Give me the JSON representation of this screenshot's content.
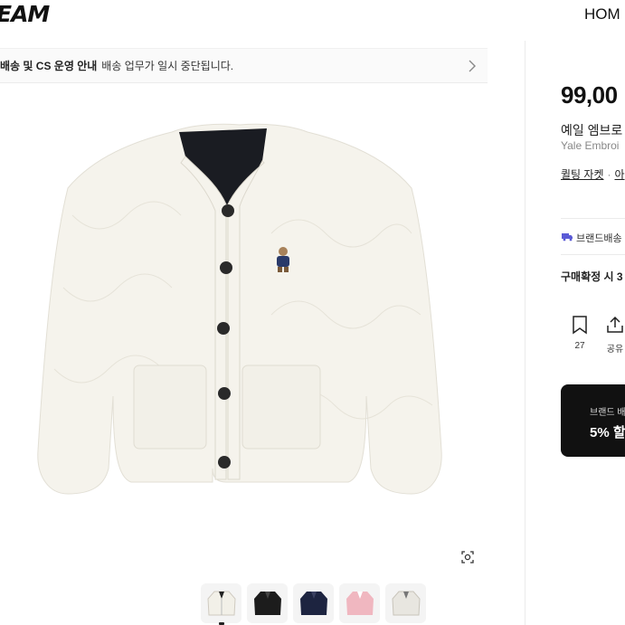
{
  "header": {
    "logo": "EAM",
    "nav_home": "HOM"
  },
  "notice": {
    "bold": "배송 및 CS 운영 안내",
    "text": "배송 업무가 일시 중단됩니다."
  },
  "product": {
    "price": "99,00",
    "name_ko": "예일 엠브로",
    "name_en": "Yale Embroi",
    "tags": [
      "퀼팅 자켓",
      "아"
    ],
    "delivery": "브랜드배송",
    "confirm": "구매확정 시 3",
    "bookmark_count": "27",
    "share_label": "공유"
  },
  "banner": {
    "line1": "브랜드 배",
    "line2": "5% 할"
  },
  "thumbnails": [
    "ivory",
    "black",
    "navy",
    "pink",
    "gray"
  ],
  "icons": [
    "chevron-right-icon",
    "zoom-icon",
    "truck-icon",
    "bookmark-icon",
    "share-icon"
  ],
  "colors": {
    "accent_truck": "#5b5bd6",
    "banner_bg": "#111111"
  }
}
